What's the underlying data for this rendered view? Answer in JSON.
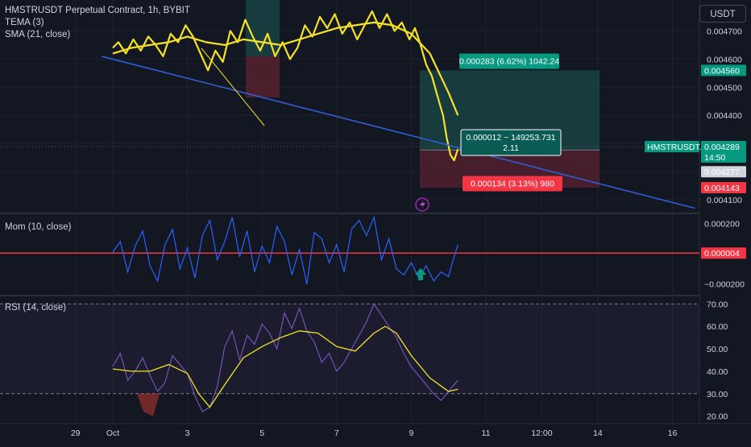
{
  "header": {
    "symbol_title": "HMSTRUSDT Perpetual Contract, 1h, BYBIT",
    "indicator_1": "TEMA (3)",
    "indicator_2": "SMA (21, close)",
    "currency": "USDT"
  },
  "mom_panel": {
    "title": "Mom (10, close)"
  },
  "rsi_panel": {
    "title": "RSI (14, close)"
  },
  "position": {
    "target_label": "0.000283 (6.62%) 1042.24",
    "center_label_1": "0.000012 ~ 149253.731",
    "center_label_2": "2.11",
    "stop_label": "0.000134 (3.13%) 980"
  },
  "colors": {
    "background": "#131722",
    "price_line": "#f5e12a",
    "trend_line": "#2f5fd7",
    "momentum": "#2962ff",
    "zero_line": "#f23645",
    "rsi_line": "#7e57c2",
    "rsi_ma": "#f5e12a",
    "profit_zone": "#1e5a56",
    "loss_zone": "#5a2230",
    "profit_tag": "#089981",
    "loss_tag": "#f23645"
  },
  "icons": {
    "alert": "lightning-icon",
    "signal": "up-arrow-icon"
  },
  "chart_data": [
    {
      "type": "line",
      "panel": "price",
      "y_ticks": [
        "0.004700",
        "0.004600",
        "0.004500",
        "0.004400",
        "0.004300",
        "0.004200",
        "0.004100"
      ],
      "ylim": [
        0.00406,
        0.00481
      ],
      "price_tags": [
        {
          "label": "0.004560",
          "value": 0.00456,
          "kind": "target"
        },
        {
          "label": "HMSTRUSDT.P",
          "value": 0.004289,
          "kind": "symbol"
        },
        {
          "label": "0.004289",
          "value": 0.004289,
          "kind": "last"
        },
        {
          "label": "14:50",
          "value": 0.004289,
          "kind": "countdown"
        },
        {
          "label": "0.004277",
          "value": 0.004277,
          "kind": "entry"
        },
        {
          "label": "0.004143",
          "value": 0.004143,
          "kind": "stop"
        }
      ],
      "position": {
        "entry": 0.004277,
        "target": 0.00456,
        "stop": 0.004143
      },
      "series": [
        {
          "name": "TEMA (3)",
          "x": [
            0,
            0.15,
            0.35,
            0.55,
            0.75,
            0.95,
            1.15,
            1.35,
            1.55,
            1.75,
            1.95,
            2.15,
            2.35,
            2.55,
            2.75,
            2.95,
            3.15,
            3.35,
            3.55,
            3.75,
            3.95,
            4.15,
            4.35,
            4.55,
            4.75,
            4.95,
            5.15,
            5.35,
            5.55,
            5.75,
            5.95,
            6.15,
            6.35,
            6.55,
            6.75,
            6.95,
            7.15,
            7.35,
            7.55,
            7.75,
            7.95,
            8.1,
            8.25,
            8.4,
            8.55,
            8.7,
            8.85,
            8.95,
            9.05,
            9.15,
            9.25
          ],
          "values": [
            0.00464,
            0.00466,
            0.00462,
            0.00467,
            0.00463,
            0.00468,
            0.00465,
            0.00461,
            0.00469,
            0.00466,
            0.00472,
            0.00468,
            0.00462,
            0.00456,
            0.00463,
            0.00459,
            0.0047,
            0.00466,
            0.00474,
            0.00468,
            0.00463,
            0.00469,
            0.00461,
            0.00466,
            0.0046,
            0.00464,
            0.00472,
            0.00468,
            0.00475,
            0.00471,
            0.00476,
            0.00469,
            0.00473,
            0.00467,
            0.00472,
            0.00477,
            0.00471,
            0.00476,
            0.0047,
            0.00473,
            0.00467,
            0.00471,
            0.00465,
            0.00458,
            0.00454,
            0.00447,
            0.0044,
            0.00432,
            0.00426,
            0.00424,
            0.00428
          ]
        },
        {
          "name": "SMA (21, close)",
          "x": [
            0,
            0.5,
            1.0,
            1.5,
            2.0,
            2.5,
            3.0,
            3.5,
            4.0,
            4.5,
            5.0,
            5.5,
            6.0,
            6.5,
            7.0,
            7.5,
            8.0,
            8.5,
            9.0,
            9.25
          ],
          "values": [
            0.00462,
            0.00464,
            0.00465,
            0.00466,
            0.00468,
            0.00466,
            0.00465,
            0.00467,
            0.00466,
            0.00465,
            0.00467,
            0.00469,
            0.00471,
            0.00472,
            0.00473,
            0.00472,
            0.00469,
            0.00462,
            0.00448,
            0.0044
          ]
        },
        {
          "name": "trendline",
          "x": [
            -0.3,
            15.6
          ],
          "values": [
            0.00461,
            0.00407
          ]
        }
      ]
    },
    {
      "type": "line",
      "panel": "momentum",
      "y_ticks": [
        "0.000200",
        "0.000004",
        "−0.000200"
      ],
      "ylim": [
        -0.00026,
        0.00026
      ],
      "zero_line": 4e-06,
      "series": [
        {
          "name": "Mom (10, close)",
          "x": [
            0,
            0.2,
            0.4,
            0.6,
            0.8,
            1.0,
            1.2,
            1.4,
            1.6,
            1.8,
            2.0,
            2.2,
            2.4,
            2.6,
            2.8,
            3.0,
            3.2,
            3.4,
            3.6,
            3.8,
            4.0,
            4.2,
            4.4,
            4.6,
            4.8,
            5.0,
            5.2,
            5.4,
            5.6,
            5.8,
            6.0,
            6.2,
            6.4,
            6.6,
            6.8,
            7.0,
            7.2,
            7.4,
            7.6,
            7.8,
            8.0,
            8.2,
            8.4,
            8.6,
            8.8,
            9.0,
            9.1,
            9.2,
            9.25
          ],
          "values": [
            1e-05,
            8e-05,
            -0.00012,
            5e-05,
            0.00015,
            -8e-05,
            -0.00018,
            6e-05,
            0.00016,
            -0.0001,
            4e-05,
            -0.00016,
            0.00012,
            0.00022,
            -4e-05,
            8e-05,
            0.00024,
            -2e-05,
            0.00015,
            -0.00012,
            5e-05,
            -6e-05,
            0.00018,
            8e-05,
            -0.00014,
            3e-05,
            -0.0002,
            0.00014,
            0.0001,
            -6e-05,
            6e-05,
            -0.00012,
            0.00016,
            0.00022,
            0.00012,
            0.00024,
            -4e-05,
            0.0001,
            -0.0001,
            -0.00014,
            -6e-05,
            -0.00016,
            -8e-05,
            -0.00018,
            -0.00012,
            -0.00015,
            -6e-05,
            2e-05,
            6e-05
          ]
        }
      ]
    },
    {
      "type": "line",
      "panel": "rsi",
      "y_ticks": [
        "70.00",
        "60.00",
        "50.00",
        "40.00",
        "30.00",
        "20.00"
      ],
      "ylim": [
        17,
        73
      ],
      "bands": [
        70,
        30
      ],
      "series": [
        {
          "name": "RSI (14, close)",
          "x": [
            0,
            0.2,
            0.4,
            0.6,
            0.8,
            1.0,
            1.2,
            1.4,
            1.6,
            1.8,
            2.0,
            2.2,
            2.4,
            2.6,
            2.8,
            3.0,
            3.2,
            3.4,
            3.6,
            3.8,
            4.0,
            4.2,
            4.4,
            4.6,
            4.8,
            5.0,
            5.2,
            5.4,
            5.6,
            5.8,
            6.0,
            6.2,
            6.4,
            6.6,
            6.8,
            7.0,
            7.2,
            7.4,
            7.6,
            7.8,
            8.0,
            8.2,
            8.4,
            8.6,
            8.8,
            9.0,
            9.1,
            9.2,
            9.25
          ],
          "values": [
            42,
            48,
            36,
            40,
            46,
            38,
            31,
            35,
            47,
            43,
            39,
            29,
            22,
            24,
            33,
            51,
            58,
            45,
            56,
            52,
            61,
            57,
            50,
            66,
            59,
            68,
            58,
            53,
            44,
            48,
            40,
            44,
            50,
            56,
            62,
            70,
            65,
            60,
            55,
            48,
            42,
            38,
            34,
            30,
            27,
            31,
            33,
            35,
            36
          ]
        },
        {
          "name": "RSI-based MA",
          "x": [
            0,
            0.5,
            1.0,
            1.5,
            2.0,
            2.3,
            2.6,
            3.0,
            3.5,
            4.0,
            4.5,
            5.0,
            5.5,
            6.0,
            6.5,
            7.0,
            7.3,
            7.6,
            8.0,
            8.5,
            9.0,
            9.25
          ],
          "values": [
            41,
            40,
            40,
            43,
            39,
            30,
            24,
            34,
            46,
            51,
            55,
            58,
            57,
            51,
            49,
            57,
            60,
            57,
            47,
            37,
            31,
            32
          ]
        }
      ]
    }
  ],
  "x_axis": {
    "ticks": [
      {
        "label": "29",
        "x": -1.0
      },
      {
        "label": "Oct",
        "x": 0.0
      },
      {
        "label": "3",
        "x": 2.0
      },
      {
        "label": "5",
        "x": 4.0
      },
      {
        "label": "7",
        "x": 6.0
      },
      {
        "label": "9",
        "x": 8.0
      },
      {
        "label": "11",
        "x": 10.0
      },
      {
        "label": "12:00",
        "x": 11.5
      },
      {
        "label": "14",
        "x": 13.0
      },
      {
        "label": "16",
        "x": 15.0
      }
    ]
  }
}
